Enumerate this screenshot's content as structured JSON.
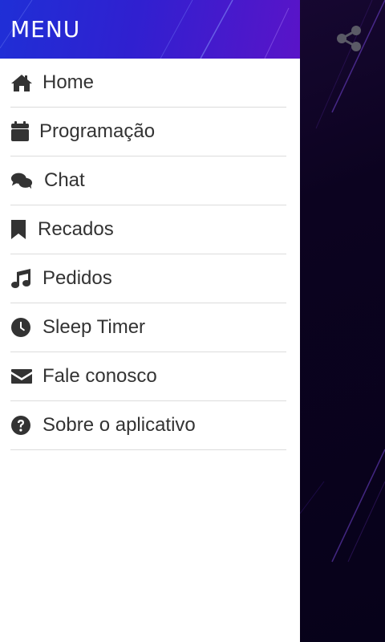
{
  "drawer": {
    "title": "MENU",
    "items": [
      {
        "label": "Home",
        "icon": "home-icon"
      },
      {
        "label": "Programação",
        "icon": "calendar-icon"
      },
      {
        "label": "Chat",
        "icon": "chat-icon"
      },
      {
        "label": "Recados",
        "icon": "bookmark-icon"
      },
      {
        "label": "Pedidos",
        "icon": "music-note-icon"
      },
      {
        "label": "Sleep Timer",
        "icon": "clock-icon"
      },
      {
        "label": "Fale conosco",
        "icon": "envelope-icon"
      },
      {
        "label": "Sobre o aplicativo",
        "icon": "question-circle-icon"
      }
    ]
  },
  "toolbar": {
    "share_icon": "share-icon"
  },
  "colors": {
    "header_gradient_start": "#1f2fd6",
    "header_gradient_end": "#5a14c8",
    "background": "#0c0320",
    "icon_color": "#333333",
    "share_icon_color": "#5a5a66"
  }
}
